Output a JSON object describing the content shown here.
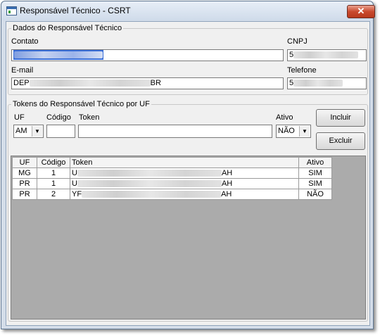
{
  "window": {
    "title": "Responsável Técnico - CSRT",
    "close_label": "✕"
  },
  "responsavel": {
    "legend": "Dados do Responsável Técnico",
    "contato_label": "Contato",
    "cnpj_label": "CNPJ",
    "cnpj_value": "5",
    "email_label": "E-mail",
    "email_prefix": "DEP",
    "email_suffix": "BR",
    "telefone_label": "Telefone",
    "telefone_value": "5"
  },
  "tokens": {
    "legend": "Tokens do Responsável Técnico por UF",
    "uf_label": "UF",
    "uf_value": "AM",
    "codigo_label": "Código",
    "codigo_value": "",
    "token_label": "Token",
    "token_value": "",
    "ativo_label": "Ativo",
    "ativo_value": "NÃO",
    "incluir_label": "Incluir",
    "excluir_label": "Excluir"
  },
  "grid": {
    "columns": [
      "UF",
      "Código",
      "Token",
      "Ativo"
    ],
    "rows": [
      {
        "uf": "MG",
        "codigo": "1",
        "token_start": "U",
        "token_end": "AH",
        "ativo": "SIM"
      },
      {
        "uf": "PR",
        "codigo": "1",
        "token_start": "U",
        "token_end": "AH",
        "ativo": "SIM"
      },
      {
        "uf": "PR",
        "codigo": "2",
        "token_start": "YF",
        "token_end": "AH",
        "ativo": "NÃO"
      }
    ]
  }
}
